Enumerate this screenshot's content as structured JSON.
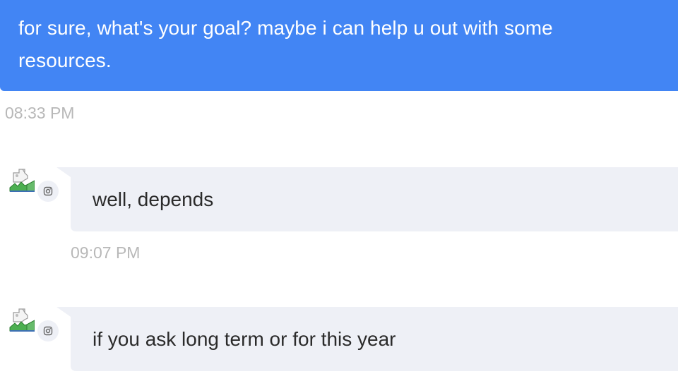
{
  "colors": {
    "outgoing_bubble": "#4285f4",
    "incoming_bubble": "#eef0f6",
    "timestamp": "#b8b8b8"
  },
  "messages": [
    {
      "direction": "outgoing",
      "text": "for sure, what's your goal? maybe i can help u out with some resources.",
      "time": "08:33 PM"
    },
    {
      "direction": "incoming",
      "avatar_icon": "broken-image-icon",
      "channel_icon": "instagram-icon",
      "text": "well, depends",
      "time": "09:07 PM"
    },
    {
      "direction": "incoming",
      "avatar_icon": "broken-image-icon",
      "channel_icon": "instagram-icon",
      "text": "if you ask long term or for this year"
    }
  ]
}
